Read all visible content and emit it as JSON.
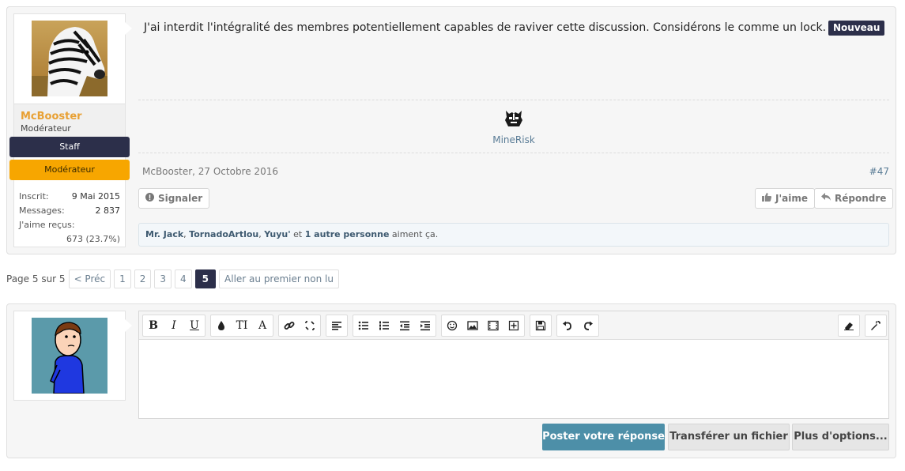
{
  "post": {
    "author": {
      "username": "McBooster",
      "title": "Modérateur",
      "ribbons": [
        "Staff",
        "Modérateur"
      ],
      "stats": [
        {
          "label": "Inscrit:",
          "value": "9 Mai 2015"
        },
        {
          "label": "Messages:",
          "value": "2 837"
        },
        {
          "label": "J'aime reçus:",
          "value": "673 (23.7%)"
        }
      ]
    },
    "message": "J'ai interdit l'intégralité des membres potentiellement capables de raviver cette discussion. Considérons le comme un lock.",
    "badge": "Nouveau",
    "signature": {
      "icon": "minerisk-logo-icon",
      "label": "MineRisk"
    },
    "meta": {
      "author_date": "McBooster, 27 Octobre 2016",
      "number": "#47"
    },
    "actions": {
      "report": "Signaler",
      "like": "J'aime",
      "reply": "Répondre"
    },
    "likes": {
      "names": [
        "Mr. Jack",
        "TornadoArtlou",
        "Yuyu'"
      ],
      "sep1": ", ",
      "sep2": ", ",
      "and": " et ",
      "others": "1 autre personne",
      "suffix": " aiment ça."
    }
  },
  "pagination": {
    "label": "Page 5 sur 5",
    "prev": "< Préc",
    "pages": [
      "1",
      "2",
      "3",
      "4",
      "5"
    ],
    "current": "5",
    "first_unread": "Aller au premier non lu"
  },
  "reply": {
    "toolbar": {
      "bold": "B",
      "italic": "I",
      "underline": "U",
      "fontsize": "TI",
      "font": "A"
    },
    "buttons": {
      "post": "Poster votre réponse",
      "upload": "Transférer un fichier",
      "more": "Plus d'options..."
    }
  },
  "colors": {
    "username": "#e8a033",
    "staff_ribbon": "#2c2f4a",
    "mod_ribbon": "#f7a600",
    "primary_button": "#4d8fa8",
    "current_page": "#2c2f4a"
  }
}
